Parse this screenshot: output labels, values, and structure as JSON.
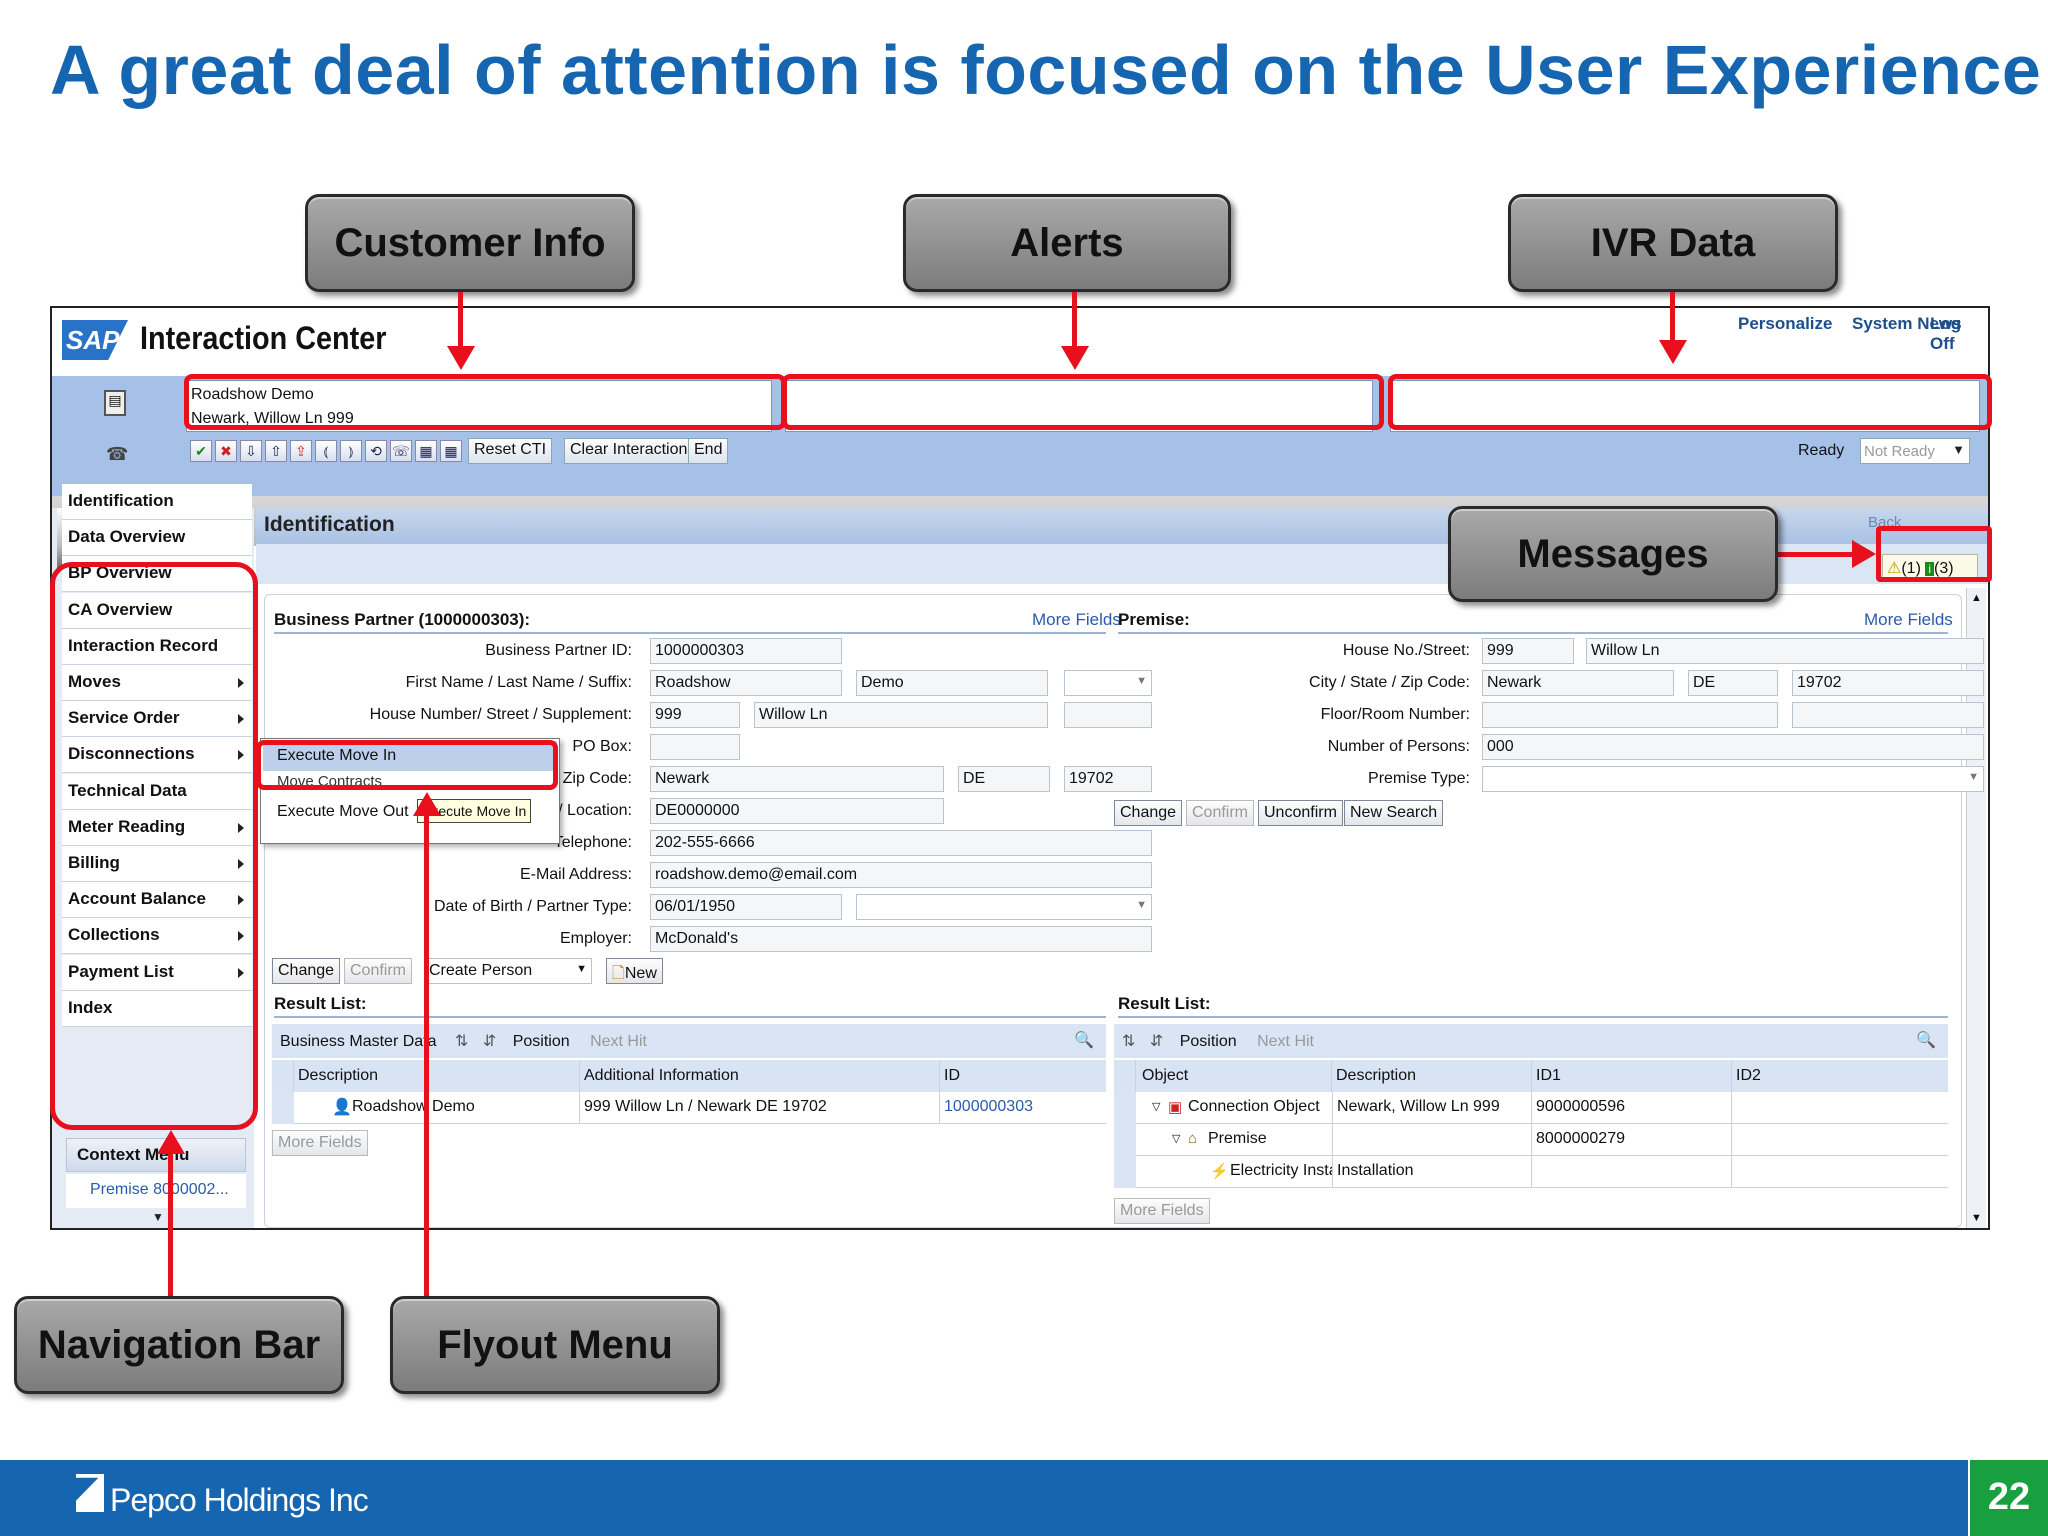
{
  "slide": {
    "title": "A great deal of attention is focused on the User Experience",
    "page_number": "22",
    "company": "Pepco Holdings Inc"
  },
  "callouts": {
    "customer_info": "Customer Info",
    "alerts": "Alerts",
    "ivr_data": "IVR Data",
    "messages": "Messages",
    "navigation_bar": "Navigation Bar",
    "flyout_menu": "Flyout Menu"
  },
  "colors": {
    "title_blue": "#1565b0",
    "highlight_red": "#e8101c",
    "sap_blue": "#a6c1e8",
    "footer_blue": "#1565b0",
    "page_green": "#18a040"
  },
  "sap": {
    "logo": "SAP",
    "title": "Interaction Center",
    "top_links": [
      "Personalize",
      "System News",
      "Log Off"
    ],
    "customer": {
      "line1": "Roadshow Demo",
      "line2": "Newark, Willow Ln 999"
    },
    "toolbar": {
      "icons": [
        "check-icon",
        "cancel-icon",
        "download-icon",
        "upload-icon",
        "transfer-icon",
        "hold-icon",
        "retrieve-icon",
        "conference-icon",
        "phone-icon",
        "grid-icon",
        "table-icon"
      ],
      "reset_cti": "Reset CTI",
      "clear_interaction": "Clear Interaction",
      "end": "End",
      "status_label": "Ready",
      "status_value": "Not Ready"
    },
    "nav_items": [
      {
        "label": "Identification",
        "has_sub": false
      },
      {
        "label": "Data Overview",
        "has_sub": false
      },
      {
        "label": "BP Overview",
        "has_sub": false
      },
      {
        "label": "CA Overview",
        "has_sub": false
      },
      {
        "label": "Interaction Record",
        "has_sub": false
      },
      {
        "label": "Moves",
        "has_sub": true
      },
      {
        "label": "Service Order",
        "has_sub": true
      },
      {
        "label": "Disconnections",
        "has_sub": true
      },
      {
        "label": "Technical Data",
        "has_sub": false
      },
      {
        "label": "Meter Reading",
        "has_sub": true
      },
      {
        "label": "Billing",
        "has_sub": true
      },
      {
        "label": "Account Balance",
        "has_sub": true
      },
      {
        "label": "Collections",
        "has_sub": true
      },
      {
        "label": "Payment List",
        "has_sub": true
      },
      {
        "label": "Index",
        "has_sub": false
      }
    ],
    "context_menu": {
      "title": "Context Menu",
      "item": "Premise 8000002..."
    },
    "page_title": "Identification",
    "back": "Back",
    "messages": {
      "warning_count": "(1)",
      "info_count": "(3)"
    },
    "bp": {
      "header": "Business Partner (1000000303):",
      "more_fields": "More Fields",
      "labels": {
        "bp_id": "Business Partner ID:",
        "name": "First Name / Last Name / Suffix:",
        "house": "House Number/ Street / Supplement:",
        "po_box": "PO Box:",
        "city": "City / State / Zip Code:",
        "region": "Region / Location:",
        "telephone": "Telephone:",
        "email": "E-Mail Address:",
        "dob": "Date of Birth / Partner Type:",
        "employer": "Employer:"
      },
      "values": {
        "bp_id": "1000000303",
        "first_name": "Roadshow",
        "last_name": "Demo",
        "house": "999",
        "street": "Willow Ln",
        "city": "Newark",
        "state": "DE",
        "zip": "19702",
        "region": "DE0000000",
        "telephone": "202-555-6666",
        "email": "roadshow.demo@email.com",
        "dob": "06/01/1950",
        "employer": "McDonald's"
      },
      "buttons": {
        "change": "Change",
        "confirm": "Confirm",
        "create": "Create Person",
        "new": "New"
      }
    },
    "premise": {
      "header": "Premise:",
      "more_fields": "More Fields",
      "labels": {
        "house": "House No./Street:",
        "city": "City / State / Zip Code:",
        "floor": "Floor/Room Number:",
        "persons": "Number of Persons:",
        "type": "Premise Type:"
      },
      "values": {
        "house": "999",
        "street": "Willow Ln",
        "city": "Newark",
        "state": "DE",
        "zip": "19702",
        "persons": "000"
      },
      "buttons": {
        "change": "Change",
        "confirm": "Confirm",
        "unconfirm": "Unconfirm",
        "new_search": "New Search"
      }
    },
    "flyout": {
      "items": [
        "Execute Move In",
        "Move Contracts",
        "Execute Move Out"
      ],
      "tooltip": "Execute Move In"
    },
    "result_left": {
      "label": "Result List:",
      "title": "Business Master Data",
      "position": "Position",
      "next_hit": "Next Hit",
      "columns": [
        "Description",
        "Additional Information",
        "ID"
      ],
      "rows": [
        [
          "Roadshow Demo",
          "999 Willow Ln / Newark DE 19702",
          "1000000303"
        ]
      ],
      "more_fields": "More Fields"
    },
    "result_right": {
      "label": "Result List:",
      "position": "Position",
      "next_hit": "Next Hit",
      "columns": [
        "Object",
        "Description",
        "ID1",
        "ID2"
      ],
      "rows": [
        [
          "Connection Object",
          "Newark, Willow Ln 999",
          "9000000596",
          ""
        ],
        [
          "Premise",
          "",
          "8000000279",
          ""
        ],
        [
          "Electricity Installa",
          "Installation",
          "",
          ""
        ]
      ],
      "more_fields": "More Fields"
    }
  }
}
